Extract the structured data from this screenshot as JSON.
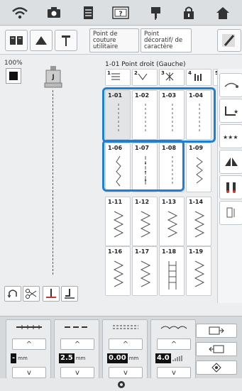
{
  "topbar": {
    "icons": [
      "wifi-icon",
      "camera-icon",
      "document-icon",
      "help-icon",
      "needle-threading-icon",
      "lock-icon",
      "home-icon"
    ]
  },
  "mode": {
    "tab_utility": "Point de couture utilitaire",
    "tab_decorative": "Point décoratif/ de caractère"
  },
  "status": {
    "zoom": "100%",
    "selected_stitch": "1-01 Point droit (Gauche)"
  },
  "stitches": {
    "top_row": [
      "1",
      "2",
      "3",
      "4",
      "5"
    ],
    "rows": [
      [
        "1-01",
        "1-02",
        "1-03",
        "1-04"
      ],
      [
        "1-06",
        "1-07",
        "1-08",
        "1-09"
      ],
      [
        "1-11",
        "1-12",
        "1-13",
        "1-14"
      ],
      [
        "1-16",
        "1-17",
        "1-18",
        "1-19"
      ]
    ]
  },
  "settings": {
    "width_value": "-",
    "length_value": "2.5",
    "length_unit": "mm",
    "width_unit": "mm",
    "tension_value": "0.00",
    "tension_unit": "mm",
    "pressure_value": "4.0"
  },
  "colors": {
    "highlight": "#1e7fd6",
    "background": "#eceeef"
  }
}
